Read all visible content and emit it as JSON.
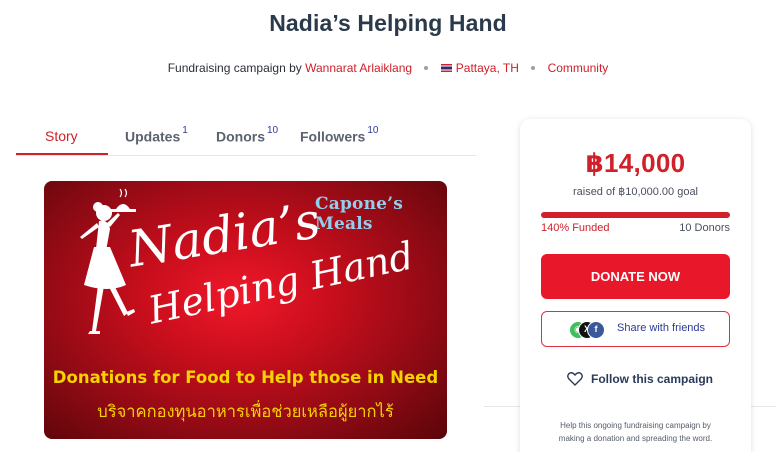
{
  "header": {
    "title": "Nadia’s Helping Hand",
    "meta_prefix": "Fundraising campaign by",
    "organizer": "Wannarat Arlaiklang",
    "location": "Pattaya, TH",
    "category": "Community",
    "location_flag_icon": "thailand-flag-icon"
  },
  "tabs": [
    {
      "label": "Story",
      "count": ""
    },
    {
      "label": "Updates",
      "count": "1"
    },
    {
      "label": "Donors",
      "count": "10"
    },
    {
      "label": "Followers",
      "count": "10"
    }
  ],
  "banner": {
    "tagline": "Capone’s Meals",
    "script_line1": "Nadia’s",
    "script_line2": "Helping Hand",
    "caption_en": "Donations for Food to Help those in Need",
    "caption_th": "บริจาคกองทุนอาหารเพื่อช่วยเหลือผู้ยากไร้"
  },
  "donation_panel": {
    "raised": "฿14,000",
    "goal_text": "raised of ฿10,000.00 goal",
    "progress_fraction": 1.0,
    "funded_text": "140% Funded",
    "donors_text": "10 Donors",
    "donate_label": "DONATE NOW",
    "share_label": "Share with friends",
    "share_icons": [
      "whatsapp-icon",
      "x-icon",
      "facebook-icon"
    ],
    "follow_label": "Follow this campaign",
    "follow_icon": "heart-icon",
    "footnote": "Help this ongoing fundraising campaign by making a donation and spreading the word."
  },
  "colors": {
    "accent": "#d0202a",
    "donate_button": "#e8172a",
    "title": "#2b3a4a",
    "link_blue": "#2b3a9a"
  }
}
